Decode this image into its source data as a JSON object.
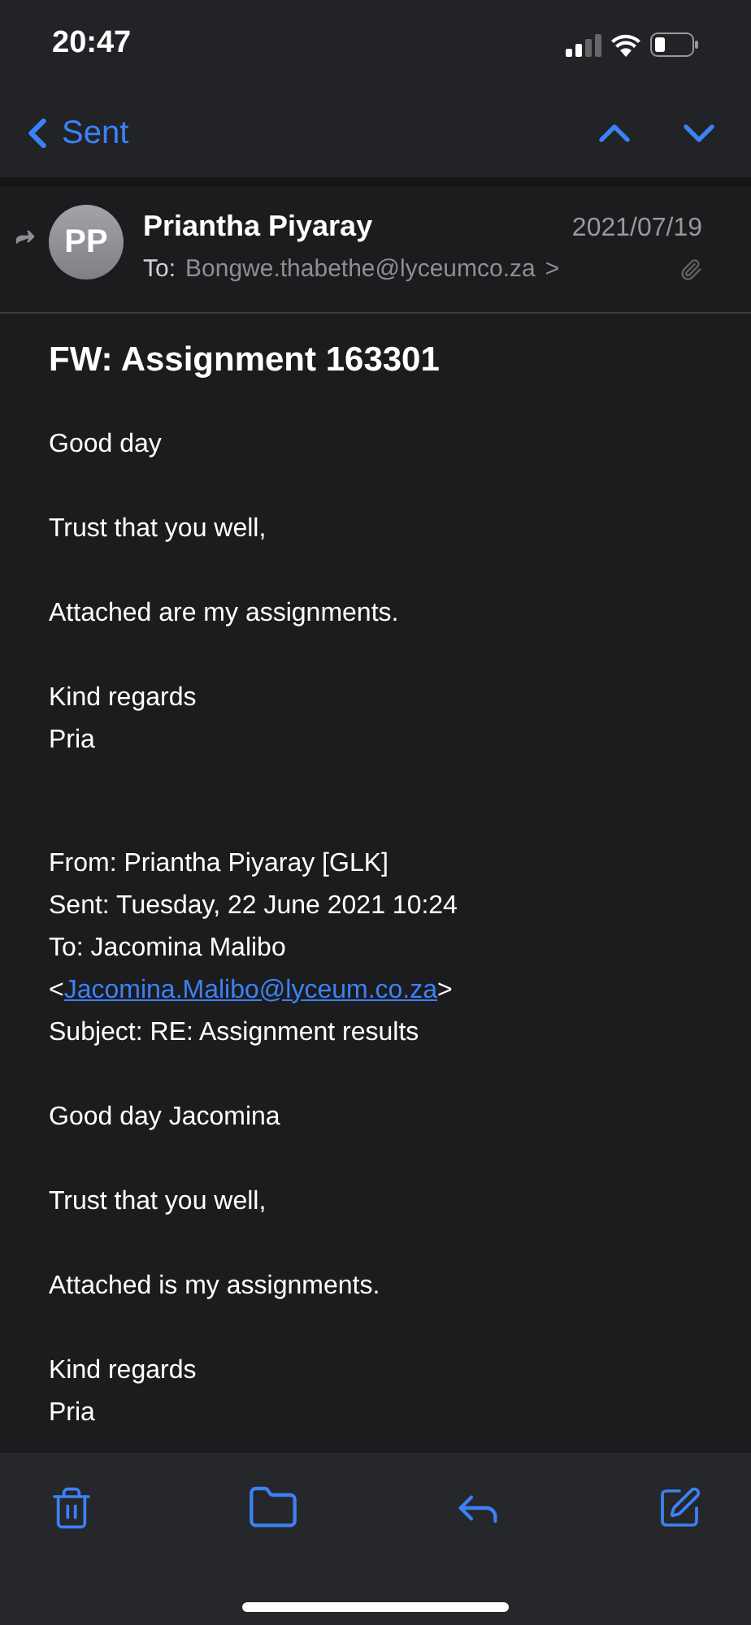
{
  "status_bar": {
    "time": "20:47"
  },
  "nav": {
    "back_label": "Sent"
  },
  "header": {
    "sender": "Priantha Piyaray",
    "initials": "PP",
    "to_label": "To:",
    "recipient": "Bongwe.thabethe@lyceumco.za",
    "chevron": ">",
    "date": "2021/07/19",
    "forwarded": true,
    "has_attachment": true
  },
  "subject": "FW: Assignment 163301",
  "message": [
    {
      "lines": [
        "Good day"
      ]
    },
    {
      "lines": [
        "Trust that you well,"
      ]
    },
    {
      "lines": [
        "Attached are my assignments."
      ]
    },
    {
      "lines": [
        "Kind regards",
        "Pria"
      ]
    }
  ],
  "forwarded": [
    {
      "lines": [
        {
          "kind": "text",
          "text": "From: Priantha Piyaray [GLK]"
        },
        {
          "kind": "text",
          "text": "Sent: Tuesday, 22 June 2021 10:24"
        },
        {
          "kind": "text",
          "text": "To: Jacomina Malibo"
        },
        {
          "kind": "link",
          "before": "<",
          "link": "Jacomina.Malibo@lyceum.co.za",
          "after": ">"
        },
        {
          "kind": "text",
          "text": "Subject: RE: Assignment results"
        }
      ]
    },
    {
      "lines": [
        {
          "kind": "text",
          "text": "Good day Jacomina"
        }
      ]
    },
    {
      "lines": [
        {
          "kind": "text",
          "text": "Trust that you well,"
        }
      ]
    },
    {
      "lines": [
        {
          "kind": "text",
          "text": "Attached is my assignments."
        }
      ]
    },
    {
      "lines": [
        {
          "kind": "text",
          "text": "Kind regards"
        },
        {
          "kind": "text",
          "text": "Pria"
        }
      ]
    }
  ]
}
